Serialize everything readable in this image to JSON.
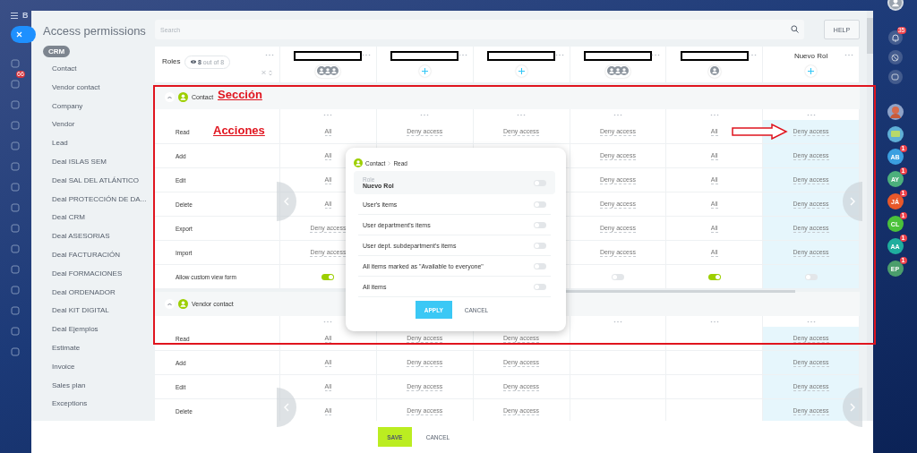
{
  "left_rail": {
    "logo_text": "B",
    "badge": "66"
  },
  "nav": {
    "title": "Access permissions",
    "section": "CRM",
    "items": [
      "Contact",
      "Vendor contact",
      "Company",
      "Vendor",
      "Lead",
      "Deal ISLAS SEM",
      "Deal SAL DEL ATLÁNTICO",
      "Deal PROTECCIÓN DE DA...",
      "Deal CRM",
      "Deal ASESORIAS",
      "Deal FACTURACIÓN",
      "Deal FORMACIONES",
      "Deal ORDENADOR",
      "Deal KIT DIGITAL",
      "Deal Ejemplos",
      "Estimate",
      "Invoice",
      "Sales plan",
      "Exceptions"
    ]
  },
  "search": {
    "placeholder": "Search"
  },
  "help_button": "HELP",
  "roles_header": {
    "title": "Roles",
    "filter": "**8** out of 8"
  },
  "roles": [
    {
      "kind": "redacted",
      "members": {
        "kind": "group"
      },
      "highlighted": false
    },
    {
      "kind": "redacted",
      "members": {
        "kind": "add"
      },
      "highlighted": false
    },
    {
      "kind": "redacted",
      "members": {
        "kind": "add"
      },
      "highlighted": false
    },
    {
      "kind": "redacted",
      "members": {
        "kind": "group"
      },
      "highlighted": false
    },
    {
      "kind": "redacted",
      "members": {
        "kind": "single"
      },
      "highlighted": false
    },
    {
      "kind": "named",
      "name": "Nuevo Rol",
      "members": {
        "kind": "add"
      },
      "highlighted": true
    }
  ],
  "sections": [
    {
      "title": "Contact",
      "expanded": true,
      "rows": [
        {
          "label": "Read",
          "cells": [
            {
              "kind": "text",
              "value": "All"
            },
            {
              "kind": "text",
              "value": "Deny access"
            },
            {
              "kind": "text",
              "value": "Deny access"
            },
            {
              "kind": "text",
              "value": "Deny access"
            },
            {
              "kind": "text",
              "value": "All"
            },
            {
              "kind": "text",
              "value": "Deny access"
            }
          ]
        },
        {
          "label": "Add",
          "cells": [
            {
              "kind": "text",
              "value": "All"
            },
            null,
            null,
            {
              "kind": "text",
              "value": "Deny access"
            },
            {
              "kind": "text",
              "value": "All"
            },
            {
              "kind": "text",
              "value": "Deny access"
            }
          ]
        },
        {
          "label": "Edit",
          "cells": [
            {
              "kind": "text",
              "value": "All"
            },
            null,
            null,
            {
              "kind": "text",
              "value": "Deny access"
            },
            {
              "kind": "text",
              "value": "All"
            },
            {
              "kind": "text",
              "value": "Deny access"
            }
          ]
        },
        {
          "label": "Delete",
          "cells": [
            {
              "kind": "text",
              "value": "All"
            },
            null,
            null,
            {
              "kind": "text",
              "value": "Deny access"
            },
            {
              "kind": "text",
              "value": "All"
            },
            {
              "kind": "text",
              "value": "Deny access"
            }
          ]
        },
        {
          "label": "Export",
          "cells": [
            {
              "kind": "text",
              "value": "Deny access"
            },
            null,
            null,
            {
              "kind": "text",
              "value": "Deny access"
            },
            {
              "kind": "text",
              "value": "All"
            },
            {
              "kind": "text",
              "value": "Deny access"
            }
          ]
        },
        {
          "label": "Import",
          "cells": [
            {
              "kind": "text",
              "value": "Deny access"
            },
            null,
            null,
            {
              "kind": "text",
              "value": "Deny access"
            },
            {
              "kind": "text",
              "value": "All"
            },
            {
              "kind": "text",
              "value": "Deny access"
            }
          ]
        },
        {
          "label": "Allow custom view form",
          "cells": [
            {
              "kind": "toggle",
              "on": true
            },
            null,
            null,
            {
              "kind": "toggle",
              "on": false
            },
            {
              "kind": "toggle",
              "on": true
            },
            {
              "kind": "toggle",
              "on": false
            }
          ]
        }
      ]
    },
    {
      "title": "Vendor contact",
      "expanded": true,
      "rows": [
        {
          "label": "Read",
          "cells": [
            {
              "kind": "text",
              "value": "All"
            },
            {
              "kind": "text",
              "value": "Deny access"
            },
            {
              "kind": "text",
              "value": "Deny access"
            },
            null,
            null,
            {
              "kind": "text",
              "value": "Deny access"
            }
          ]
        },
        {
          "label": "Add",
          "cells": [
            {
              "kind": "text",
              "value": "All"
            },
            {
              "kind": "text",
              "value": "Deny access"
            },
            {
              "kind": "text",
              "value": "Deny access"
            },
            null,
            null,
            {
              "kind": "text",
              "value": "Deny access"
            }
          ]
        },
        {
          "label": "Edit",
          "cells": [
            {
              "kind": "text",
              "value": "All"
            },
            {
              "kind": "text",
              "value": "Deny access"
            },
            {
              "kind": "text",
              "value": "Deny access"
            },
            null,
            null,
            {
              "kind": "text",
              "value": "Deny access"
            }
          ]
        },
        {
          "label": "Delete",
          "cells": [
            {
              "kind": "text",
              "value": "All"
            },
            {
              "kind": "text",
              "value": "Deny access"
            },
            {
              "kind": "text",
              "value": "Deny access"
            },
            null,
            null,
            {
              "kind": "text",
              "value": "Deny access"
            }
          ]
        }
      ]
    }
  ],
  "popup": {
    "section": "Contact",
    "action": "Read",
    "role_label": "Role",
    "role_name": "Nuevo Rol",
    "role_on": false,
    "options": [
      {
        "label": "User's items",
        "on": false
      },
      {
        "label": "User department's items",
        "on": false
      },
      {
        "label": "User dept. subdepartment's items",
        "on": false
      },
      {
        "label": "All items marked as \"Available to everyone\"",
        "on": false
      },
      {
        "label": "All items",
        "on": false
      }
    ],
    "apply": "APPLY",
    "cancel": "CANCEL"
  },
  "annotations": {
    "section_label": "Sección",
    "actions_label": "Acciones"
  },
  "footer": {
    "save": "SAVE",
    "cancel": "CANCEL"
  },
  "right_rail": {
    "notifications_badge": "35",
    "contacts": [
      {
        "initials": "AB",
        "color": "#3b9fe0",
        "badge": "1"
      },
      {
        "initials": "AY",
        "color": "#4cb07c",
        "badge": "1"
      },
      {
        "initials": "JÁ",
        "color": "#e8582a",
        "badge": "1"
      },
      {
        "initials": "CL",
        "color": "#4bc23a",
        "badge": "1"
      },
      {
        "initials": "AA",
        "color": "#1fae9e",
        "badge": "1"
      },
      {
        "initials": "EP",
        "color": "#4b9e6c",
        "badge": "1"
      }
    ]
  }
}
